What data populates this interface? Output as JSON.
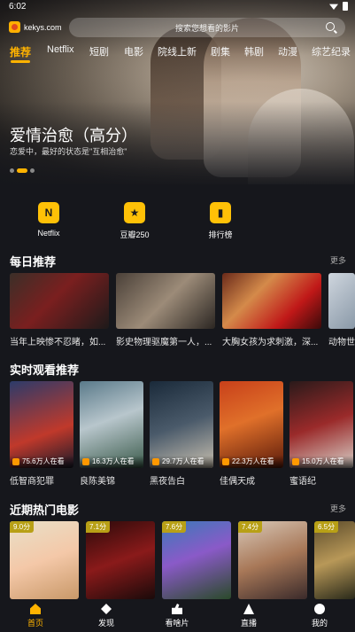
{
  "status": {
    "time": "6:02"
  },
  "brand": {
    "name": "kekys.com"
  },
  "search": {
    "placeholder": "搜索您想看的影片"
  },
  "tabs": [
    "推荐",
    "Netflix",
    "短剧",
    "电影",
    "院线上新",
    "剧集",
    "韩剧",
    "动漫",
    "综艺纪录"
  ],
  "hero": {
    "title": "爱情治愈（高分）",
    "subtitle": "恋爱中，最好的状态是\"互相治愈\""
  },
  "quick": [
    {
      "label": "Netflix",
      "icon": "netflix-icon",
      "glyph": "N"
    },
    {
      "label": "豆瓣250",
      "icon": "douban-icon",
      "glyph": "★"
    },
    {
      "label": "排行榜",
      "icon": "chart-icon",
      "glyph": "▮"
    }
  ],
  "daily": {
    "title": "每日推荐",
    "more": "更多",
    "items": [
      {
        "caption": "当年上映惨不忍睹，如..."
      },
      {
        "caption": "影史物理驱魔第一人，..."
      },
      {
        "caption": "大胸女孩为求刺激，深..."
      },
      {
        "caption": "动物世"
      }
    ]
  },
  "live": {
    "title": "实时观看推荐",
    "items": [
      {
        "name": "低智商犯罪",
        "watching": "75.6万人在看"
      },
      {
        "name": "良陈美锦",
        "watching": "16.3万人在看"
      },
      {
        "name": "黑夜告白",
        "watching": "29.7万人在看"
      },
      {
        "name": "佳偶天成",
        "watching": "22.3万人在看"
      },
      {
        "name": "蜜语纪",
        "watching": "15.0万人在看"
      }
    ]
  },
  "hot": {
    "title": "近期热门电影",
    "more": "更多",
    "items": [
      {
        "score": "9.0分"
      },
      {
        "score": "7.1分"
      },
      {
        "score": "7.6分"
      },
      {
        "score": "7.4分"
      },
      {
        "score": "6.5分"
      }
    ]
  },
  "nav": [
    {
      "label": "首页",
      "icon": "home-icon"
    },
    {
      "label": "发现",
      "icon": "discover-icon"
    },
    {
      "label": "看啥片",
      "icon": "thumbs-up-icon"
    },
    {
      "label": "直播",
      "icon": "live-icon"
    },
    {
      "label": "我的",
      "icon": "profile-icon"
    }
  ],
  "colors": {
    "accent": "#ffb300",
    "background": "#16171c"
  }
}
